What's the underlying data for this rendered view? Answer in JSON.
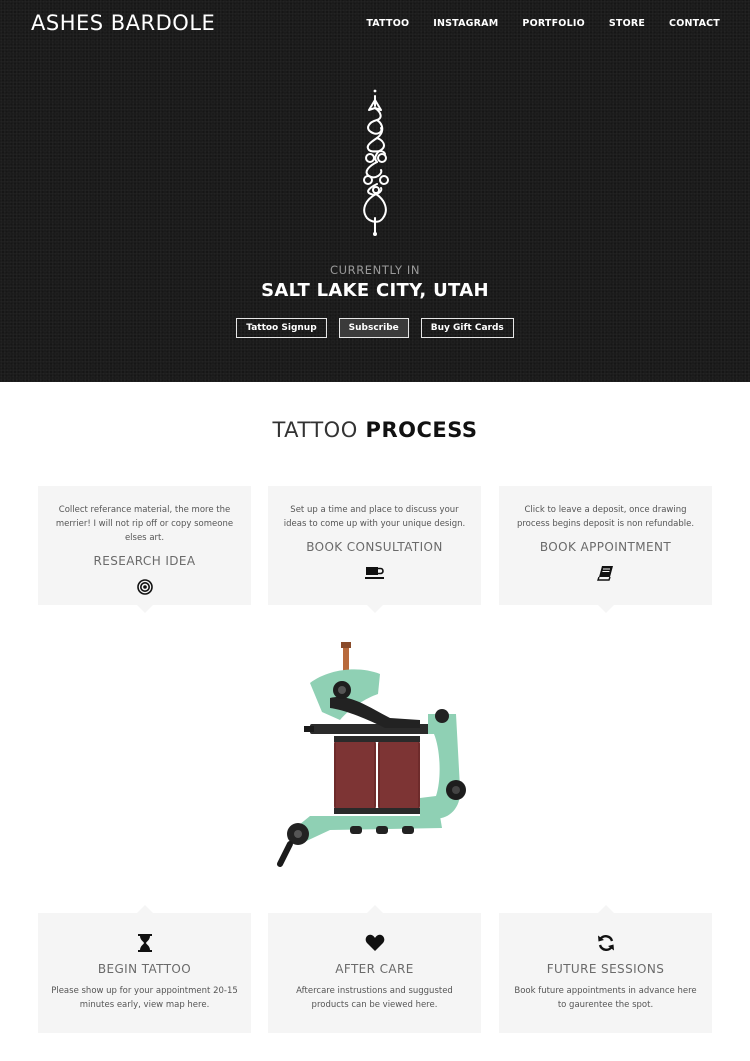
{
  "header": {
    "brand": "ASHES BARDOLE",
    "nav": [
      "TATTOO",
      "INSTAGRAM",
      "PORTFOLIO",
      "STORE",
      "CONTACT"
    ]
  },
  "hero": {
    "logo_icon": "unalome-symbol",
    "currently_label": "CURRENTLY IN",
    "location": "SALT LAKE CITY, UTAH",
    "buttons": [
      "Tattoo Signup",
      "Subscribe",
      "Buy Gift Cards"
    ]
  },
  "process": {
    "title_light": "TATTOO",
    "title_bold": "PROCESS",
    "steps_top": [
      {
        "desc": "Collect referance material, the more the merrier! I will not rip off or copy someone elses art.",
        "title": "RESEARCH IDEA",
        "icon": "target-icon"
      },
      {
        "desc": "Set up a time and place to discuss your ideas to come up with your unique design.",
        "title": "BOOK CONSULTATION",
        "icon": "coffee-icon"
      },
      {
        "desc": "Click to leave a deposit, once drawing process begins deposit is non refundable.",
        "title": "BOOK APPOINTMENT",
        "icon": "book-icon"
      }
    ],
    "machine_image": "tattoo-machine",
    "steps_bottom": [
      {
        "desc": "Please show up for your appointment 20-15 minutes early, view map here.",
        "title": "BEGIN TATTOO",
        "icon": "hourglass-icon"
      },
      {
        "desc": "Aftercare instrustions and suggusted products can be viewed here.",
        "title": "AFTER CARE",
        "icon": "heart-icon"
      },
      {
        "desc": "Book future appointments in advance here to gaurentee the spot.",
        "title": "FUTURE SESSIONS",
        "icon": "refresh-icon"
      }
    ]
  },
  "colors": {
    "hero_bg": "#1b1b1b",
    "card_bg": "#f5f5f5",
    "machine_frame": "#8fd0b4",
    "machine_coils": "#6e2b2b"
  }
}
